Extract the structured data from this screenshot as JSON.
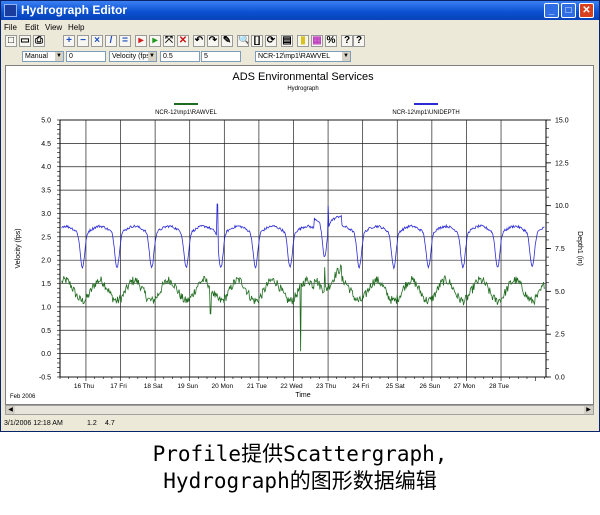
{
  "window": {
    "title": "Hydrograph Editor",
    "minimize": "_",
    "maximize": "□",
    "close": "✕"
  },
  "menu": [
    "File",
    "Edit",
    "View",
    "Help"
  ],
  "toolbar": {
    "icons": [
      "new-icon",
      "open-icon",
      "print-icon",
      "add-point-icon",
      "remove-point-icon",
      "delete-icon",
      "draw-line-icon",
      "equals-icon",
      "red-flag-icon",
      "green-flag-icon",
      "select-icon",
      "cross-icon",
      "undo-icon",
      "redo-icon",
      "edit-icon",
      "zoom-icon",
      "fit-icon",
      "refresh-icon",
      "save-icon",
      "yellow-bar-icon",
      "color-grid-icon",
      "percent-icon",
      "help-icon",
      "whats-this-icon"
    ],
    "glyphs": [
      "□",
      "▭",
      "⎙",
      "+",
      "−",
      "×",
      "/",
      "=",
      "▸",
      "▸",
      "⤧",
      "✕",
      "↶",
      "↷",
      "✎",
      "🔍",
      "[]",
      "⟳",
      "▤",
      "▮",
      "▦",
      "%",
      "?",
      "?"
    ]
  },
  "options": {
    "mode": "Manual",
    "mode_value": "0",
    "entity": "Velocity (fps)",
    "entity_value1": "0.5",
    "entity_value2": "5",
    "location": "NCR-12\\mp1\\RAWVEL"
  },
  "chart_data": {
    "type": "line",
    "title": "ADS Environmental Services",
    "subtitle": "Hydrograph",
    "xlabel": "Time",
    "ylabel": "Velocity (fps)",
    "y2label": "Depth1 (in)",
    "month_label": "Feb 2006",
    "x_ticks": [
      "16 Thu",
      "17 Fri",
      "18 Sat",
      "19 Sun",
      "20 Mon",
      "21 Tue",
      "22 Wed",
      "23 Thu",
      "24 Fri",
      "25 Sat",
      "26 Sun",
      "27 Mon",
      "28 Tue"
    ],
    "xlim": [
      15.25,
      29.3
    ],
    "ylim": [
      -0.5,
      5.0
    ],
    "y_ticks": [
      "5.0",
      "4.5",
      "4.0",
      "3.5",
      "3.0",
      "2.5",
      "2.0",
      "1.5",
      "1.0",
      "0.5",
      "0.0",
      "-0.5"
    ],
    "y2lim": [
      0.0,
      15.0
    ],
    "y2_ticks": [
      "15.0",
      "12.5",
      "10.0",
      "7.5",
      "5.0",
      "2.5",
      "0.0"
    ],
    "grid": true,
    "legend": "top",
    "series": [
      {
        "name": "NCR-12\\mp1\\RAWVEL",
        "color": "#1f6b1f",
        "axis": "left",
        "base": 1.35,
        "daily_amplitude": 0.22,
        "noise": 0.12,
        "features": [
          {
            "x": 22.2,
            "value": 0.05
          },
          {
            "x": 19.6,
            "value": 0.85
          },
          {
            "x": 22.9,
            "value": 1.85
          }
        ]
      },
      {
        "name": "NCR-12\\mp1\\UNIDEPTH",
        "color": "#2b2bd4",
        "axis": "right",
        "base_depth": 8.6,
        "daily_amplitude": 0.9,
        "noise": 0.15,
        "features": [
          {
            "x": 19.8,
            "value": 10.1
          },
          {
            "x": 23.0,
            "value": 10.0
          }
        ]
      }
    ]
  },
  "status": {
    "datetime": "3/1/2006 12:18 AM",
    "value1": "1.2",
    "value2": "4.7"
  },
  "caption": {
    "line1": "Profile提供Scattergraph,",
    "line2": "Hydrograph的图形数据编辑"
  }
}
